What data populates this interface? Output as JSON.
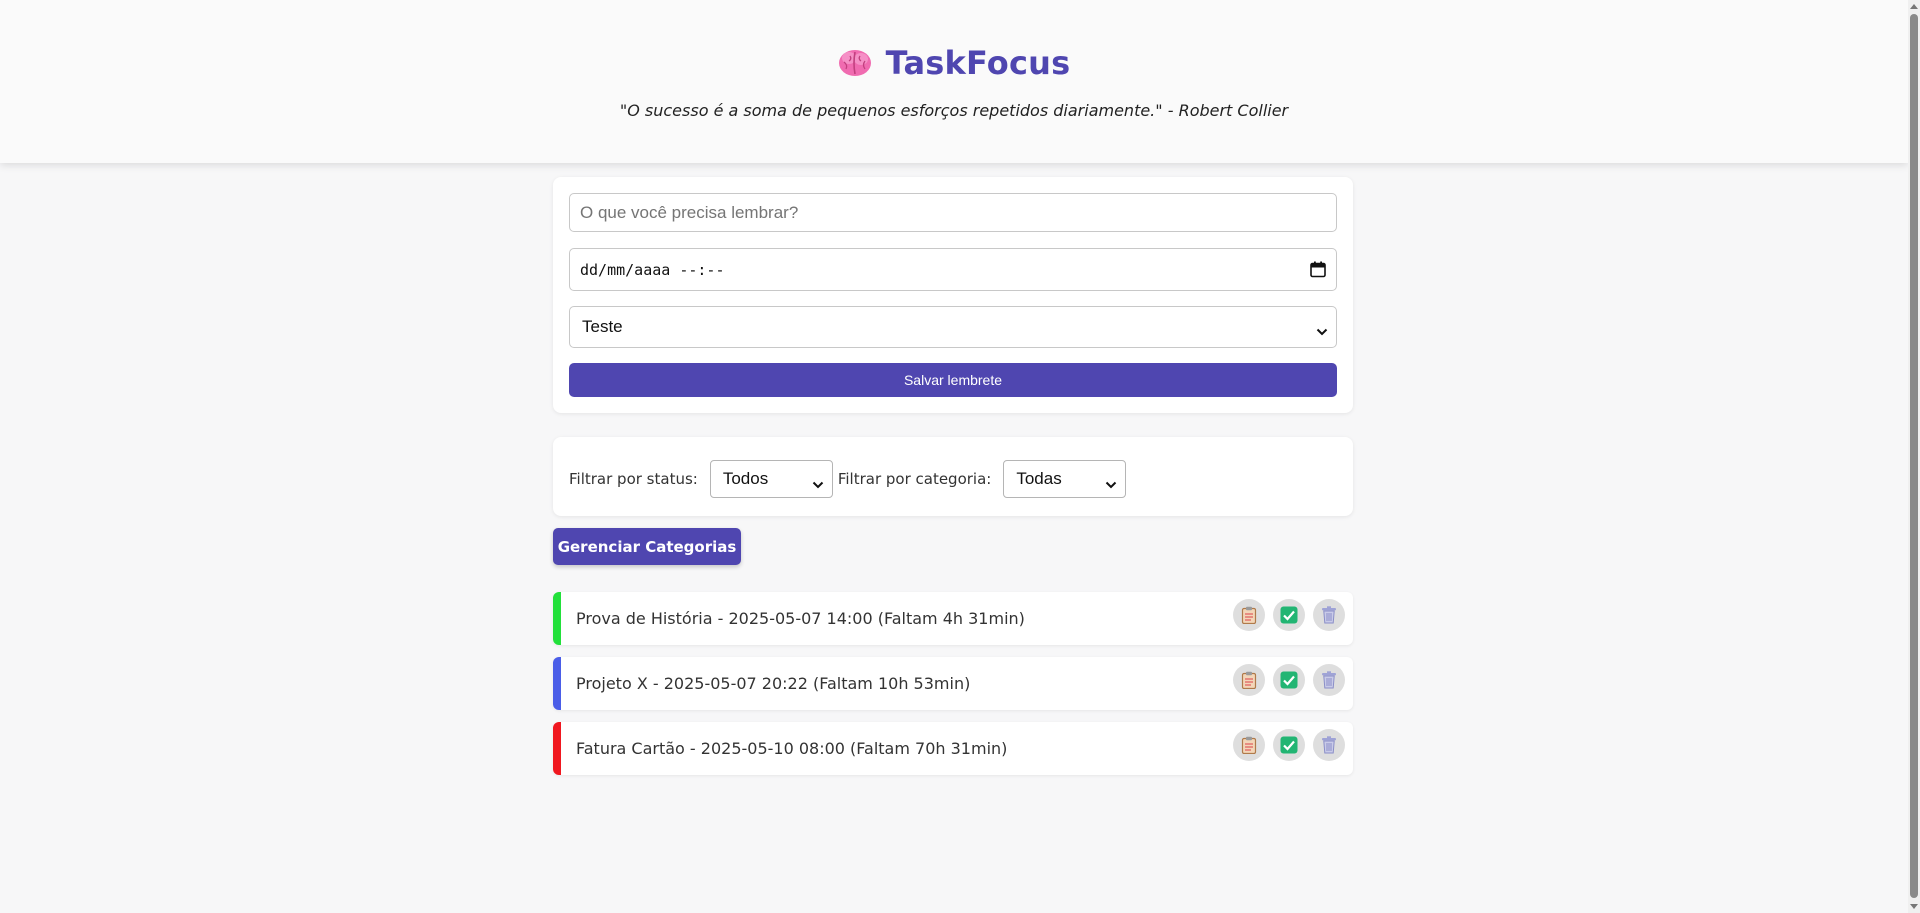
{
  "header": {
    "icon": "brain-icon",
    "app_name": "TaskFocus",
    "quote": "\"O sucesso é a soma de pequenos esforços repetidos diariamente.\" - Robert Collier"
  },
  "form": {
    "text_placeholder": "O que você precisa lembrar?",
    "datetime_placeholder": "dd/mm/aaaa --:--",
    "category_selected": "Teste",
    "save_label": "Salvar lembrete"
  },
  "filters": {
    "status_label": "Filtrar por status:",
    "status_selected": "Todos",
    "category_label": "Filtrar por categoria:",
    "category_selected": "Todas"
  },
  "manage_categories_label": "Gerenciar Categorias",
  "tasks": [
    {
      "text": "Prova de História - 2025-05-07 14:00 (Faltam 4h 31min)",
      "color": "#22e03a"
    },
    {
      "text": "Projeto X - 2025-05-07 20:22 (Faltam 10h 53min)",
      "color": "#4a5de8"
    },
    {
      "text": "Fatura Cartão - 2025-05-10 08:00 (Faltam 70h 31min)",
      "color": "#f0171f"
    }
  ],
  "colors": {
    "accent": "#4f46b0",
    "background": "#f7f7f8"
  }
}
